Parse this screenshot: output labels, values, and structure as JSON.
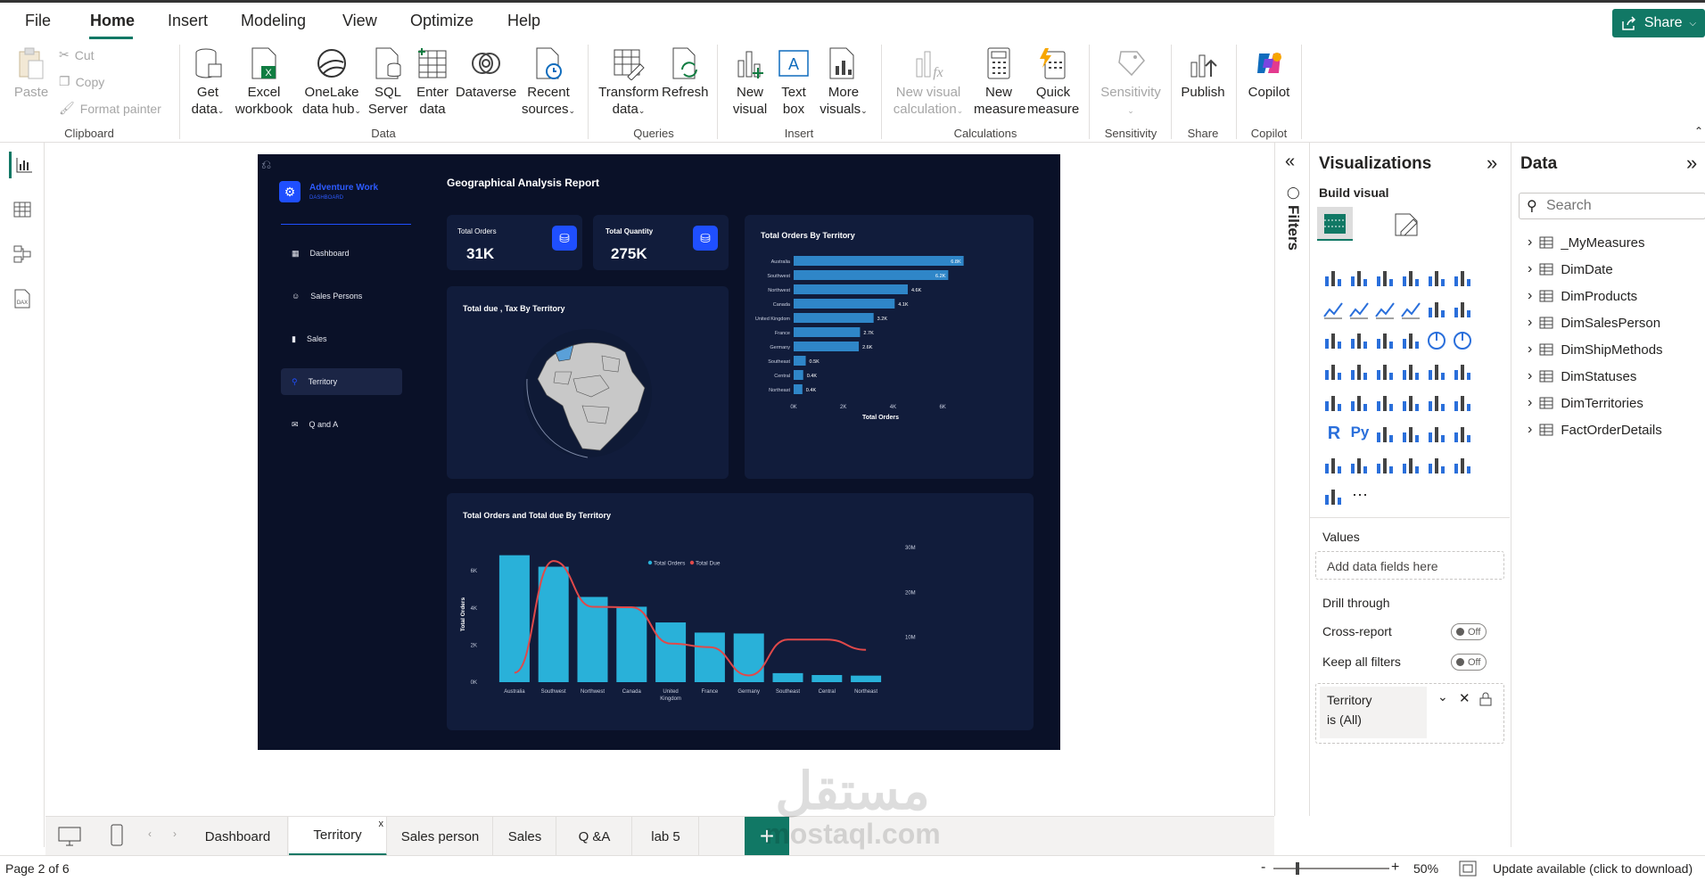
{
  "menu": {
    "file": "File",
    "home": "Home",
    "insert": "Insert",
    "modeling": "Modeling",
    "view": "View",
    "optimize": "Optimize",
    "help": "Help",
    "share": "Share"
  },
  "ribbon": {
    "clipboard": {
      "paste": "Paste",
      "cut": "Cut",
      "copy": "Copy",
      "format_painter": "Format painter",
      "group": "Clipboard"
    },
    "data": {
      "get_data_1": "Get",
      "get_data_2": "data",
      "excel_1": "Excel",
      "excel_2": "workbook",
      "onelake_1": "OneLake",
      "onelake_2": "data hub",
      "sql_1": "SQL",
      "sql_2": "Server",
      "enter_1": "Enter",
      "enter_2": "data",
      "dataverse": "Dataverse",
      "recent_1": "Recent",
      "recent_2": "sources",
      "group": "Data"
    },
    "queries": {
      "transform_1": "Transform",
      "transform_2": "data",
      "refresh": "Refresh",
      "group": "Queries"
    },
    "insert": {
      "new_visual_1": "New",
      "new_visual_2": "visual",
      "text_box_1": "Text",
      "text_box_2": "box",
      "more_1": "More",
      "more_2": "visuals",
      "group": "Insert"
    },
    "calculations": {
      "nvc_1": "New visual",
      "nvc_2": "calculation",
      "nm_1": "New",
      "nm_2": "measure",
      "qm_1": "Quick",
      "qm_2": "measure",
      "group": "Calculations"
    },
    "sensitivity": {
      "label": "Sensitivity",
      "group": "Sensitivity"
    },
    "share": {
      "publish": "Publish",
      "group": "Share"
    },
    "copilot": {
      "label": "Copilot",
      "group": "Copilot"
    }
  },
  "report": {
    "brand": {
      "title": "Adventure Work",
      "subtitle": "DASHBOARD"
    },
    "title": "Geographical Analysis Report",
    "nav": [
      {
        "label": "Dashboard"
      },
      {
        "label": "Sales Persons"
      },
      {
        "label": "Sales"
      },
      {
        "label": "Territory"
      },
      {
        "label": "Q and A"
      }
    ],
    "kpi_orders": {
      "label": "Total Orders",
      "value": "31K"
    },
    "kpi_qty": {
      "label": "Total Quantity",
      "value": "275K"
    },
    "map_title": "Total due , Tax By Territory",
    "bar_title": "Total Orders By Territory",
    "combo_title": "Total Orders and Total due By Territory"
  },
  "chart_data": [
    {
      "type": "bar",
      "title": "Total Orders By Territory",
      "xlabel": "Total Orders",
      "categories": [
        "Australia",
        "Southwest",
        "Northwest",
        "Canada",
        "United Kingdom",
        "France",
        "Germany",
        "Southeast",
        "Central",
        "Northeast"
      ],
      "values": [
        6843,
        6224,
        4594,
        4067,
        3219,
        2672,
        2623,
        486,
        385,
        352
      ],
      "value_labels": [
        "6.8K",
        "6.2K",
        "4.6K",
        "4.1K",
        "3.2K",
        "2.7K",
        "2.6K",
        "0.5K",
        "0.4K",
        "0.4K"
      ],
      "xticks": [
        "0K",
        "2K",
        "4K",
        "6K"
      ],
      "xlim": [
        0,
        7000
      ]
    },
    {
      "type": "bar",
      "title": "Total Orders and Total due By Territory",
      "ylabel": "Total Orders",
      "legend": [
        "Total Orders",
        "Total Due"
      ],
      "legend_position": "top",
      "categories": [
        "Australia",
        "Southwest",
        "Northwest",
        "Canada",
        "United Kingdom",
        "France",
        "Germany",
        "Southeast",
        "Central",
        "Northeast"
      ],
      "series": [
        {
          "name": "Total Orders",
          "values": [
            6843,
            6224,
            4594,
            4067,
            3219,
            2672,
            2623,
            486,
            385,
            352
          ],
          "axis": "left"
        },
        {
          "name": "Total Due",
          "values": [
            2.1,
            27.0,
            16.8,
            16.7,
            8.6,
            7.8,
            1.5,
            9.5,
            9.5,
            7.2
          ],
          "axis": "right",
          "kind": "line"
        }
      ],
      "yticks_left": [
        "0K",
        "2K",
        "4K",
        "6K"
      ],
      "ylim_left": [
        0,
        7500
      ],
      "yticks_right": [
        "10M",
        "20M",
        "30M"
      ],
      "ylim_right": [
        0,
        31000000
      ]
    }
  ],
  "filters": {
    "label": "Filters"
  },
  "visualizations": {
    "title": "Visualizations",
    "build_visual": "Build visual",
    "values": "Values",
    "add_fields": "Add data fields here",
    "drill_through": "Drill through",
    "cross_report": "Cross-report",
    "keep_filters": "Keep all filters",
    "off": "Off",
    "filter_card_field": "Territory",
    "filter_card_value": "is (All)"
  },
  "data_pane": {
    "title": "Data",
    "search_placeholder": "Search",
    "tables": [
      "_MyMeasures",
      "DimDate",
      "DimProducts",
      "DimSalesPerson",
      "DimShipMethods",
      "DimStatuses",
      "DimTerritories",
      "FactOrderDetails"
    ]
  },
  "pages": [
    "Dashboard",
    "Territory",
    "Sales person",
    "Sales",
    "Q &A",
    "lab 5"
  ],
  "status": {
    "page": "Page 2 of 6",
    "zoom": "50%",
    "update": "Update available (click to download)"
  },
  "watermark": {
    "arabic": "مستقل",
    "latin": "mostaql.com"
  }
}
